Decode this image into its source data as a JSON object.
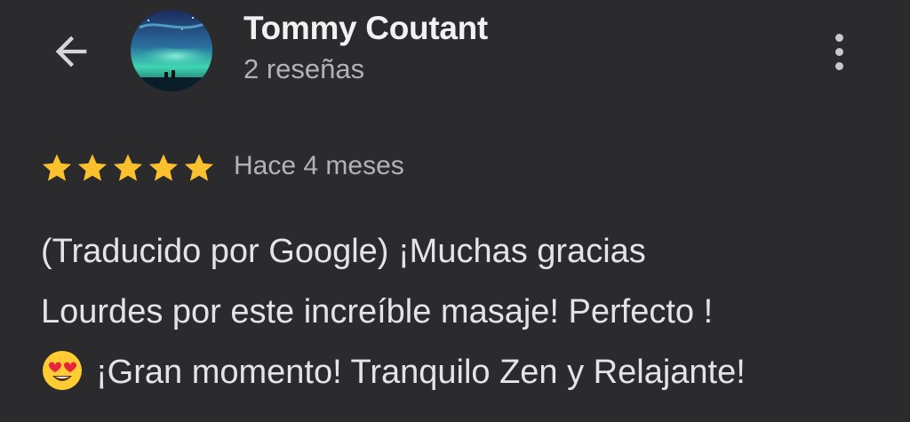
{
  "header": {
    "back_icon": "arrow-back-icon",
    "user_name": "Tommy Coutant",
    "review_count": "2 reseñas",
    "more_icon": "more-vertical-icon"
  },
  "review": {
    "rating": 5,
    "rating_max": 5,
    "star_color": "#fbc02d",
    "time": "Hace 4 meses",
    "text_lines": [
      "(Traducido por Google) ¡Muchas gracias",
      "Lourdes por este increíble masaje! Perfecto !",
      "¡Gran momento! Tranquilo Zen y Relajante!"
    ],
    "emoji": "heart-eyes-emoji"
  },
  "colors": {
    "background": "#2b2b2d",
    "primary_text": "#e4e4e6",
    "secondary_text": "#b3b3b6"
  }
}
